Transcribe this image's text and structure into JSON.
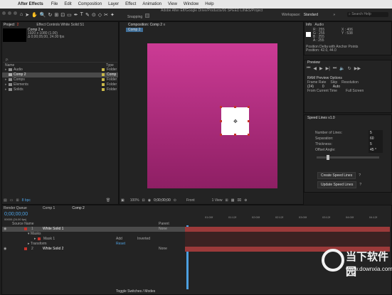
{
  "menubar": {
    "app_name": "After Effects",
    "items": [
      "File",
      "Edit",
      "Composition",
      "Layer",
      "Effect",
      "Animation",
      "View",
      "Window",
      "Help"
    ]
  },
  "toolbar": {
    "doc_path": "Adobe After Eff/Google Drive/Products/06 SPEED LINES/Project",
    "snapping_label": "Snapping",
    "workspace_label": "Workspace:",
    "workspace_value": "Standard",
    "search_placeholder": "Search Help"
  },
  "project_panel": {
    "tab_project": "Project",
    "tab_count": "2",
    "tab_effect_controls": "Effect Controls White Solid S1",
    "comp_name": "Comp 2 ▾",
    "comp_info_line1": "1920 x 1080 (1.00)",
    "comp_info_line2": "Δ 0;00;05;00, 24.00 fps",
    "search_placeholder": "ρ.",
    "col_name": "Name",
    "col_type": "Type",
    "items": [
      {
        "name": "Audio",
        "type": "Folder",
        "color": "#c9b84a"
      },
      {
        "name": "Comp 2",
        "type": "Comp",
        "color": "#c9b84a",
        "selected": true
      },
      {
        "name": "Comps",
        "type": "Folder",
        "color": "#c9b84a"
      },
      {
        "name": "Elements",
        "type": "Folder",
        "color": "#c9b84a"
      },
      {
        "name": "Solids",
        "type": "Folder",
        "color": "#c9b84a"
      }
    ],
    "bpc_label": "8 bpc"
  },
  "composition_panel": {
    "tab_label": "Composition: Comp 2",
    "tab_count": "≡",
    "subtab": "Comp 2",
    "zoom": "100%",
    "timecode": "0;00;00;00",
    "view_mode": "Front",
    "view_count": "1 View",
    "canvas_gradient_top": "#cc3b95",
    "canvas_gradient_bottom": "#8e1f64"
  },
  "info_panel": {
    "tab_info": "Info",
    "tab_audio": "Audio",
    "r_label": "R : 255",
    "g_label": "G : 255",
    "b_label": "B : 255",
    "a_label": "A : 255",
    "x_label": "X : 406",
    "y_label": "Y : 538",
    "position_line1": "Position Delta with Anchor Points",
    "position_line2": "Position: 42.0, 44.0"
  },
  "preview_panel": {
    "title": "Preview",
    "ram_label": "RAM Preview Options",
    "frame_rate_label": "Frame Rate",
    "skip_label": "Skip",
    "resolution_label": "Resolution",
    "frame_rate_value": "(24)",
    "skip_value": "0",
    "resolution_value": "Auto",
    "from_current_label": "From Current Time",
    "full_screen_label": "Full Screen"
  },
  "speed_lines_panel": {
    "title": "Speed Lines v1.0",
    "fields": [
      {
        "label": "Number of Lines:",
        "value": "5"
      },
      {
        "label": "Separation:",
        "value": "60"
      },
      {
        "label": "Thickness:",
        "value": "5"
      },
      {
        "label": "Offset Angle:",
        "value": "45 °"
      }
    ],
    "create_button": "Create Speed Lines",
    "update_button": "Update Speed Lines",
    "help_glyph": "?"
  },
  "timeline_panel": {
    "tab_render": "Render Queue",
    "tab_comp1": "Comp 1",
    "tab_comp2": "Comp 2",
    "timecode": "0;00;00;00",
    "fps_info": "00000 (24.00 fps)",
    "col_source": "Source Name",
    "col_parent": "Parent",
    "layers": [
      {
        "num": "1",
        "name": "White Solid 1",
        "parent": "None",
        "selected": true
      },
      {
        "num": "",
        "name": "Masks",
        "parent": "",
        "indent": 1
      },
      {
        "num": "",
        "name": "Mask 1",
        "parent": "Inverted",
        "mode": "Add",
        "indent": 2
      },
      {
        "num": "",
        "name": "Transform",
        "parent": "Reset",
        "indent": 1
      },
      {
        "num": "2",
        "name": "White Solid 2",
        "parent": "None"
      }
    ],
    "toggle_label": "Toggle Switches / Modes",
    "ruler_marks": [
      "01:00f",
      "01:12f",
      "02:00f",
      "02:12f",
      "03:00f",
      "03:12f",
      "04:00f",
      "04:12f"
    ],
    "track_color": "#b53a3a"
  },
  "watermark": {
    "title": "当下软件园",
    "url": "www.downxia.com"
  }
}
